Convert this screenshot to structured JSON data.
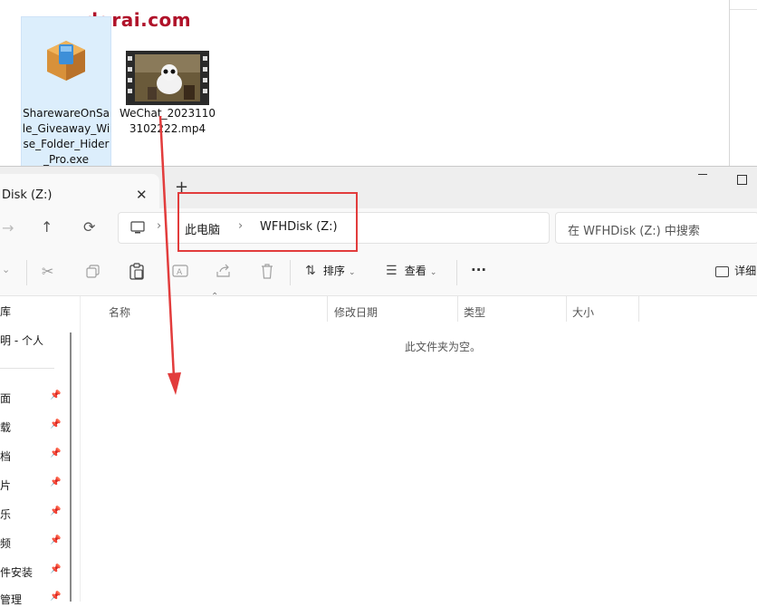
{
  "watermark": "www.dgrai.com",
  "desktop": {
    "files": [
      {
        "label": "SharewareOnSale_Giveaway_Wise_Folder_Hider_Pro.exe",
        "icon": "installer-box-icon",
        "selected": true
      },
      {
        "label": "WeChat_20231103102222.mp4",
        "icon": "video-thumbnail-icon",
        "selected": false
      }
    ]
  },
  "explorer": {
    "tab_title": "Disk (Z:)",
    "tab_close": "✕",
    "tab_add": "+",
    "nav": {
      "back": "←",
      "forward": "→",
      "up": "↑",
      "refresh": "⟳"
    },
    "breadcrumb": [
      "此电脑",
      "WFHDisk (Z:)"
    ],
    "breadcrumb_sep": "›",
    "search_placeholder": "在 WFHDisk (Z:) 中搜索",
    "toolbar": {
      "sort_label": "排序",
      "view_label": "查看",
      "more_label": "···",
      "details_label": "详细"
    },
    "sidebar": {
      "items": [
        {
          "label": "库",
          "pinned": false
        },
        {
          "label": "明 - 个人",
          "pinned": false
        },
        {
          "label": "面",
          "pinned": true
        },
        {
          "label": "载",
          "pinned": true
        },
        {
          "label": "档",
          "pinned": true
        },
        {
          "label": "片",
          "pinned": true
        },
        {
          "label": "乐",
          "pinned": true
        },
        {
          "label": "频",
          "pinned": true
        },
        {
          "label": "件安装",
          "pinned": true
        },
        {
          "label": "管理",
          "pinned": true
        }
      ]
    },
    "columns": [
      "名称",
      "修改日期",
      "类型",
      "大小"
    ],
    "empty_message": "此文件夹为空。"
  },
  "annotation_color": "#e23c3c"
}
